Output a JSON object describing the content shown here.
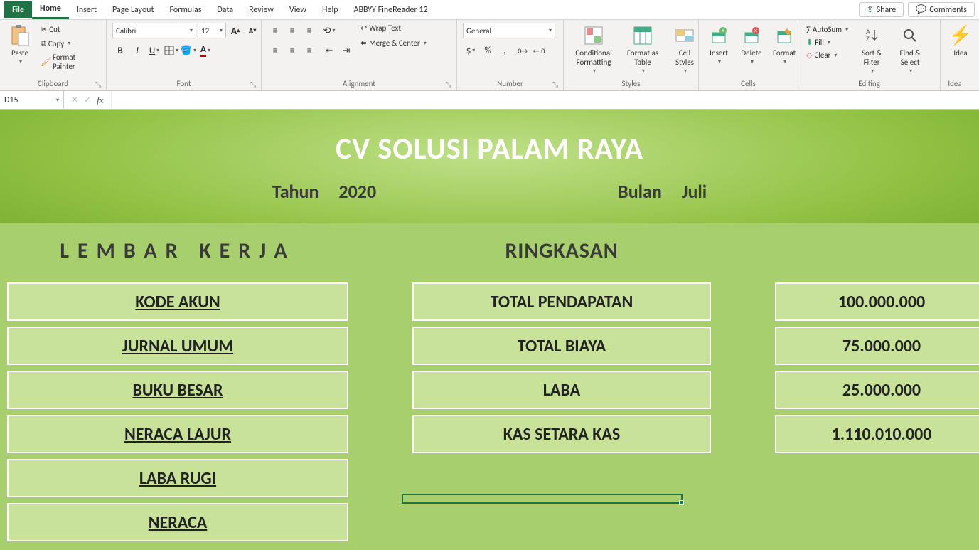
{
  "menu": {
    "file": "File",
    "tabs": [
      "Home",
      "Insert",
      "Page Layout",
      "Formulas",
      "Data",
      "Review",
      "View",
      "Help",
      "ABBYY FineReader 12"
    ],
    "active": "Home",
    "share": "Share",
    "comments": "Comments"
  },
  "ribbon": {
    "clipboard": {
      "label": "Clipboard",
      "paste": "Paste",
      "cut": "Cut",
      "copy": "Copy",
      "fmtpainter": "Format Painter"
    },
    "font": {
      "label": "Font",
      "name": "Calibri",
      "size": "12",
      "incA": "A",
      "decA": "A"
    },
    "alignment": {
      "label": "Alignment",
      "wrap": "Wrap Text",
      "merge": "Merge & Center"
    },
    "number": {
      "label": "Number",
      "format": "General"
    },
    "styles": {
      "label": "Styles",
      "cond": "Conditional Formatting",
      "table": "Format as Table",
      "cell": "Cell Styles"
    },
    "cells": {
      "label": "Cells",
      "insert": "Insert",
      "delete": "Delete",
      "format": "Format"
    },
    "editing": {
      "label": "Editing",
      "autosum": "AutoSum",
      "fill": "Fill",
      "clear": "Clear",
      "sort": "Sort & Filter",
      "find": "Find & Select"
    },
    "ideas": {
      "label": "Idea",
      "btn": "Idea"
    }
  },
  "fbar": {
    "cell": "D15",
    "formula": ""
  },
  "dash": {
    "company": "CV SOLUSI PALAM RAYA",
    "year_lbl": "Tahun",
    "year": "2020",
    "month_lbl": "Bulan",
    "month": "Juli",
    "worksheet_title": "LEMBAR KERJA",
    "summary_title": "RINGKASAN",
    "links": [
      "KODE AKUN",
      "JURNAL UMUM",
      "BUKU BESAR",
      "NERACA LAJUR",
      "LABA RUGI",
      "NERACA"
    ],
    "summary_labels": [
      "TOTAL PENDAPATAN",
      "TOTAL BIAYA",
      "LABA",
      "KAS SETARA KAS"
    ],
    "summary_values": [
      "100.000.000",
      "75.000.000",
      "25.000.000",
      "1.110.010.000"
    ]
  }
}
